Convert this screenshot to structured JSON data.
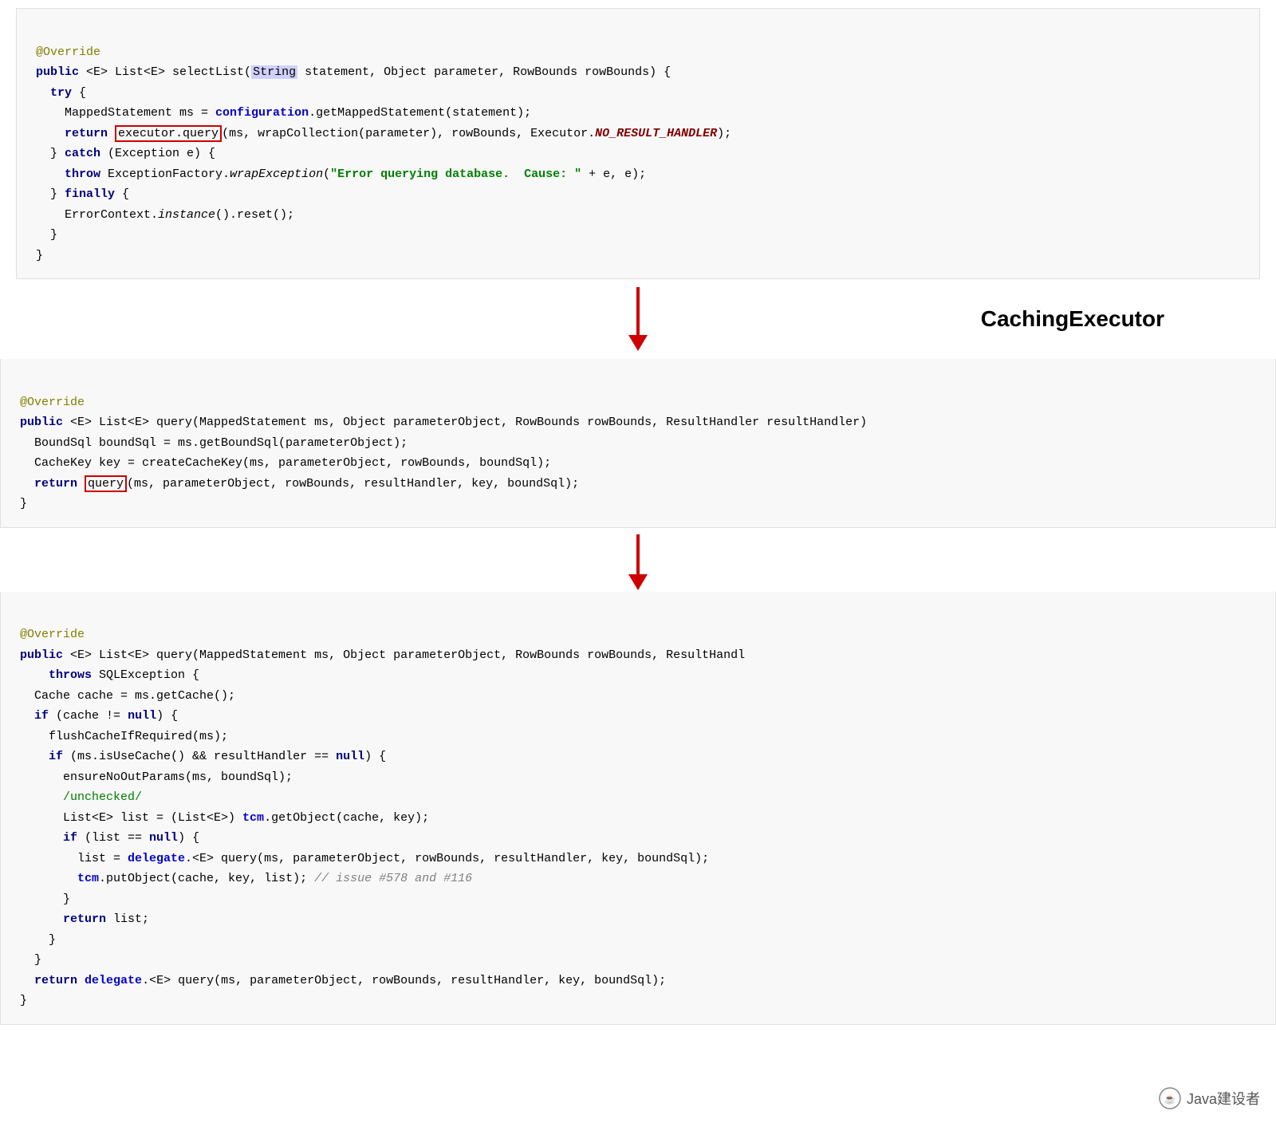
{
  "code_block_1": {
    "lines": [
      {
        "type": "annotation",
        "text": "@Override"
      },
      {
        "type": "mixed",
        "parts": [
          {
            "t": "keyword",
            "v": "public "
          },
          {
            "t": "plain",
            "v": "<E> List<E> selectList("
          },
          {
            "t": "highlight-type",
            "v": "String"
          },
          {
            "t": "plain",
            "v": " statement, Object parameter, RowBounds rowBounds) {"
          }
        ]
      },
      {
        "type": "mixed",
        "parts": [
          {
            "t": "indent1"
          },
          {
            "t": "keyword",
            "v": "try"
          },
          {
            "t": "plain",
            "v": " {"
          }
        ]
      },
      {
        "type": "mixed",
        "parts": [
          {
            "t": "indent2"
          },
          {
            "t": "plain",
            "v": "MappedStatement ms = "
          },
          {
            "t": "config",
            "v": "configuration"
          },
          {
            "t": "plain",
            "v": ".getMappedStatement(statement);"
          }
        ]
      },
      {
        "type": "mixed",
        "parts": [
          {
            "t": "indent2"
          },
          {
            "t": "keyword",
            "v": "return "
          },
          {
            "t": "highlight-box",
            "v": "executor.query"
          },
          {
            "t": "plain",
            "v": "(ms, wrapCollection(parameter), rowBounds, Executor."
          },
          {
            "t": "italic-bold",
            "v": "NO_RESULT_HANDLER"
          },
          {
            "t": "plain",
            "v": ");"
          }
        ]
      },
      {
        "type": "mixed",
        "parts": [
          {
            "t": "indent1"
          },
          {
            "t": "plain",
            "v": "} "
          },
          {
            "t": "keyword",
            "v": "catch"
          },
          {
            "t": "plain",
            "v": " (Exception e) {"
          }
        ]
      },
      {
        "type": "mixed",
        "parts": [
          {
            "t": "indent2"
          },
          {
            "t": "keyword",
            "v": "throw"
          },
          {
            "t": "plain",
            "v": " ExceptionFactory."
          },
          {
            "t": "italic",
            "v": "wrapException"
          },
          {
            "t": "plain",
            "v": "("
          },
          {
            "t": "string",
            "v": "\"Error querying database.  Cause: \""
          },
          {
            "t": "plain",
            "v": " + e, e);"
          }
        ]
      },
      {
        "type": "mixed",
        "parts": [
          {
            "t": "indent1"
          },
          {
            "t": "plain",
            "v": "} "
          },
          {
            "t": "keyword",
            "v": "finally"
          },
          {
            "t": "plain",
            "v": " {"
          }
        ]
      },
      {
        "type": "mixed",
        "parts": [
          {
            "t": "indent2"
          },
          {
            "t": "plain",
            "v": "ErrorContext."
          },
          {
            "t": "italic",
            "v": "instance"
          },
          {
            "t": "plain",
            "v": "().reset();"
          }
        ]
      },
      {
        "type": "plain",
        "parts": [
          {
            "t": "indent1"
          },
          {
            "t": "plain",
            "v": "}"
          }
        ]
      },
      {
        "type": "plain",
        "parts": [
          {
            "t": "plain",
            "v": "}"
          }
        ]
      }
    ]
  },
  "caching_executor_label": "CachingExecutor",
  "code_block_2": {
    "lines": [
      {
        "text": "@Override",
        "color": "annotation"
      },
      {
        "text": "public <E> List<E> query(MappedStatement ms, Object parameterObject, RowBounds rowBounds, ResultHandler resultHandler)"
      },
      {
        "text": "  BoundSql boundSql = ms.getBoundSql(parameterObject);"
      },
      {
        "text": "  CacheKey key = createCacheKey(ms, parameterObject, rowBounds, boundSql);"
      },
      {
        "text": "  return [query](ms, parameterObject, rowBounds, resultHandler, key, boundSql);"
      },
      {
        "text": "}"
      }
    ]
  },
  "code_block_3": {
    "lines": [
      {
        "text": "@Override",
        "color": "annotation"
      },
      {
        "text": "public <E> List<E> query(MappedStatement ms, Object parameterObject, RowBounds rowBounds, ResultHandl"
      },
      {
        "text": "    throws SQLException {"
      },
      {
        "text": "  Cache cache = ms.getCache();"
      },
      {
        "text": "  if (cache != null) {"
      },
      {
        "text": "    flushCacheIfRequired(ms);"
      },
      {
        "text": "    if (ms.isUseCache() && resultHandler == null) {"
      },
      {
        "text": "      ensureNoOutParams(ms, boundSql);"
      },
      {
        "text": "      /unchecked/"
      },
      {
        "text": "      List<E> list = (List<E>) tcm.getObject(cache, key);"
      },
      {
        "text": "      if (list == null) {"
      },
      {
        "text": "        list = delegate.<E> query(ms, parameterObject, rowBounds, resultHandler, key, boundSql);"
      },
      {
        "text": "        tcm.putObject(cache, key, list); // issue #578 and #116"
      },
      {
        "text": "      }"
      },
      {
        "text": "      return list;"
      },
      {
        "text": "    }"
      },
      {
        "text": "  }"
      },
      {
        "text": "  return delegate.<E> query(ms, parameterObject, rowBounds, resultHandler, key, boundSql);"
      },
      {
        "text": "}"
      }
    ]
  },
  "watermark": {
    "text": "Java建设者"
  }
}
